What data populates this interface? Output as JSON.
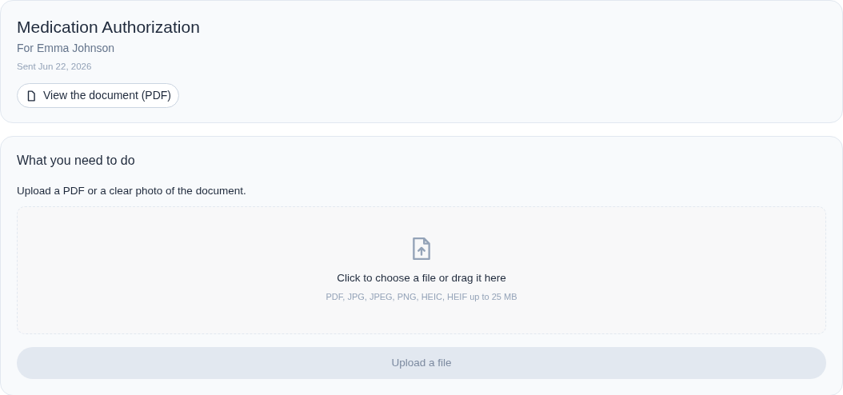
{
  "header": {
    "title": "Medication Authorization",
    "patient": "For Emma Johnson",
    "sent": "Sent Jun 22, 2026",
    "view_button": "View the document (PDF)"
  },
  "task": {
    "heading": "What you need to do",
    "instruction": "Upload a PDF or a clear photo of the document.",
    "dropzone": {
      "prompt": "Click to choose a file or drag it here",
      "hint": "PDF, JPG, JPEG, PNG, HEIC, HEIF up to 25 MB"
    },
    "upload_button": {
      "label": "Upload a file",
      "disabled": true
    }
  }
}
